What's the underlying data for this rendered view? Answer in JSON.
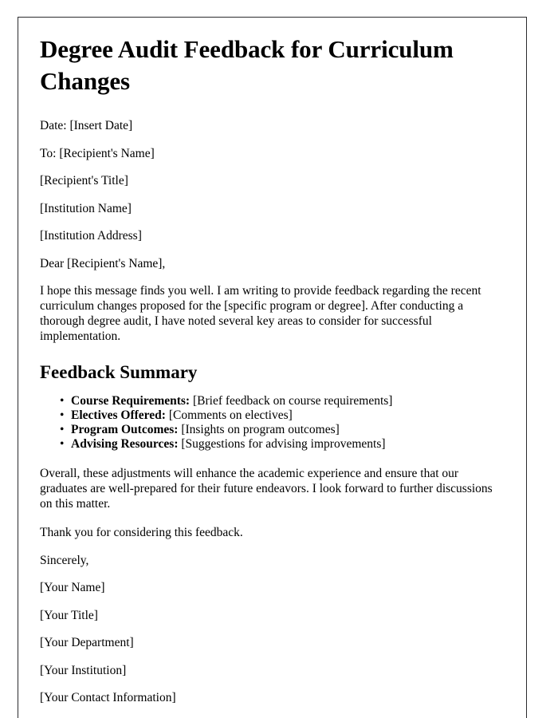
{
  "document": {
    "title": "Degree Audit Feedback for Curriculum Changes",
    "header_fields": {
      "date": "Date: [Insert Date]",
      "to": "To: [Recipient's Name]",
      "recipient_title": "[Recipient's Title]",
      "institution_name": "[Institution Name]",
      "institution_address": "[Institution Address]"
    },
    "salutation": "Dear [Recipient's Name],",
    "opening_paragraph": "I hope this message finds you well. I am writing to provide feedback regarding the recent curriculum changes proposed for the [specific program or degree]. After conducting a thorough degree audit, I have noted several key areas to consider for successful implementation.",
    "section_heading": "Feedback Summary",
    "feedback_items": [
      {
        "label": "Course Requirements:",
        "value": "[Brief feedback on course requirements]"
      },
      {
        "label": "Electives Offered:",
        "value": "[Comments on electives]"
      },
      {
        "label": "Program Outcomes:",
        "value": "[Insights on program outcomes]"
      },
      {
        "label": "Advising Resources:",
        "value": "[Suggestions for advising improvements]"
      }
    ],
    "closing_paragraph": "Overall, these adjustments will enhance the academic experience and ensure that our graduates are well-prepared for their future endeavors. I look forward to further discussions on this matter.",
    "thanks_line": "Thank you for considering this feedback.",
    "signoff": "Sincerely,",
    "signature_block": [
      "[Your Name]",
      "[Your Title]",
      "[Your Department]",
      "[Your Institution]",
      "[Your Contact Information]"
    ]
  }
}
